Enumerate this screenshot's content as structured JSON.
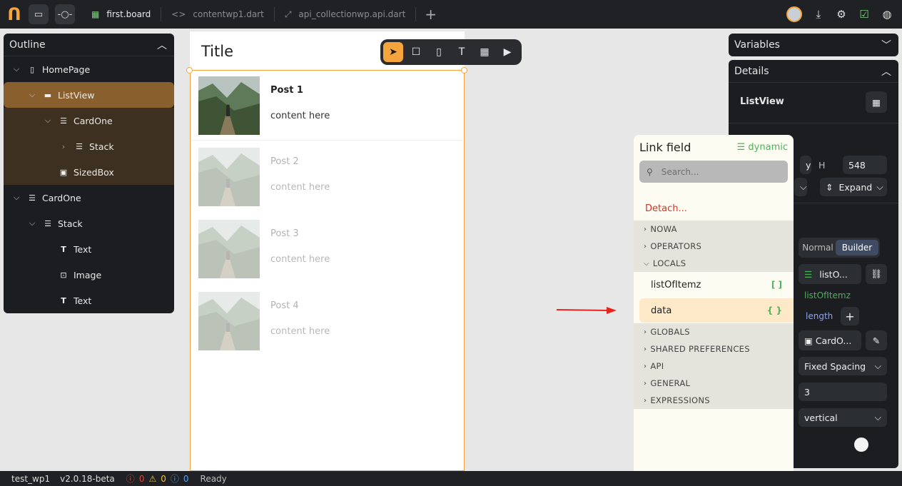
{
  "topbar": {
    "tabs": [
      {
        "label": "first.board",
        "icon": "grid-icon",
        "active": true
      },
      {
        "label": "contentwp1.dart",
        "icon": "code-icon",
        "active": false
      },
      {
        "label": "api_collectionwp.api.dart",
        "icon": "link-icon",
        "active": false
      }
    ]
  },
  "outline": {
    "title": "Outline",
    "items": [
      {
        "label": "HomePage",
        "icon": "phone-icon"
      },
      {
        "label": "ListView",
        "icon": "list-view-icon"
      },
      {
        "label": "CardOne",
        "icon": "column-icon"
      },
      {
        "label": "Stack",
        "icon": "stack-icon"
      },
      {
        "label": "SizedBox",
        "icon": "sized-box-icon"
      },
      {
        "label": "CardOne",
        "icon": "column-icon"
      },
      {
        "label": "Stack",
        "icon": "stack-icon"
      },
      {
        "label": "Text",
        "icon": "text-icon"
      },
      {
        "label": "Image",
        "icon": "image-icon"
      },
      {
        "label": "Text",
        "icon": "text-icon"
      }
    ]
  },
  "canvas": {
    "title": "Title",
    "posts": [
      {
        "title": "Post 1",
        "body": "content here"
      },
      {
        "title": "Post 2",
        "body": "content here"
      },
      {
        "title": "Post 3",
        "body": "content here"
      },
      {
        "title": "Post 4",
        "body": "content here"
      }
    ]
  },
  "variables": {
    "title": "Variables"
  },
  "details": {
    "title": "Details",
    "widget_name": "ListView",
    "h_label": "H",
    "h_value": "548",
    "expand": "Expand",
    "mode_normal": "Normal",
    "mode_builder": "Builder",
    "list_pill": "listO...",
    "list_binding": "listOfItemz",
    "length": "length",
    "card_pill": "CardO...",
    "spacing": "Fixed Spacing",
    "spacing_value": "3",
    "direction": "vertical"
  },
  "link_field": {
    "title": "Link field",
    "dynamic_label": "dynamic",
    "search_placeholder": "Search...",
    "detach": "Detach...",
    "groups_top": [
      "NOWA",
      "OPERATORS",
      "LOCALS"
    ],
    "locals": [
      {
        "label": "listOfItemz",
        "type": "[ ]"
      },
      {
        "label": "data",
        "type": "{ }"
      }
    ],
    "groups_bottom": [
      "GLOBALS",
      "SHARED PREFERENCES",
      "API",
      "GENERAL",
      "EXPRESSIONS"
    ]
  },
  "status": {
    "project": "test_wp1",
    "version": "v2.0.18-beta",
    "errors": "0",
    "warnings": "0",
    "infos": "0",
    "state": "Ready"
  },
  "colors": {
    "accent": "#f5a53b",
    "dynamic": "#4cb35a",
    "danger": "#d2352a"
  }
}
